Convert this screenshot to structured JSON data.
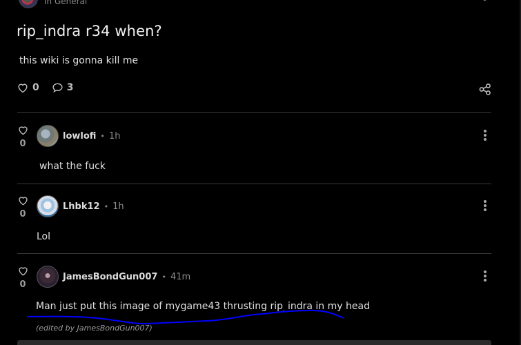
{
  "post": {
    "community": "In General",
    "title": "rip_indra r34 when?",
    "body": "this wiki is gonna kill me",
    "likes": "0",
    "comments": "3"
  },
  "icons": {
    "like": "heart-outline-icon",
    "comment": "speech-bubble-icon",
    "share": "share-nodes-icon",
    "more": "kebab-vertical-icon"
  },
  "comments": [
    {
      "user": "lowlofi",
      "time": "1h",
      "votes": "0",
      "text": "what the fuck"
    },
    {
      "user": "Lhbk12",
      "time": "1h",
      "votes": "0",
      "text": "Lol"
    },
    {
      "user": "JamesBondGun007",
      "time": "41m",
      "votes": "0",
      "text": "Man just put this image of mygame43 thrusting rip_indra in my head",
      "edited": "(edited by JamesBondGun007)"
    }
  ],
  "separator": "•",
  "colors": {
    "background": "#000000",
    "annotation_stroke": "#0000ff",
    "divider": "#3a3a3a"
  }
}
